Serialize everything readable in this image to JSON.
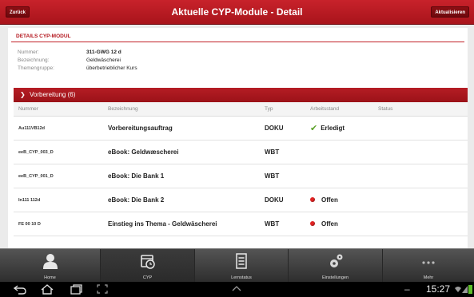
{
  "header": {
    "back_label": "Zurück",
    "title": "Aktuelle CYP-Module - Detail",
    "refresh_label": "Aktualisieren"
  },
  "details": {
    "heading": "DETAILS CYP-MODUL",
    "fields": [
      {
        "label": "Nummer:",
        "value": "311-GWG 12 d"
      },
      {
        "label": "Bezeichnung:",
        "value": "Geldwäscherei"
      },
      {
        "label": "Themengruppe:",
        "value": "überbetrieblicher Kurs"
      }
    ]
  },
  "section": {
    "title": "Vorbereitung (6)"
  },
  "table": {
    "headers": [
      "Nummer",
      "Bezeichnung",
      "Typ",
      "Arbeitsstand",
      "Status"
    ],
    "rows": [
      {
        "nummer": "Au111VB12d",
        "bezeichnung": "Vorbereitungsauftrag",
        "typ": "DOKU",
        "arbeitsstand": "Erledigt",
        "state": "done"
      },
      {
        "nummer": "eeB_CYP_003_D",
        "bezeichnung": "eBook: Geldwæscherei",
        "typ": "WBT",
        "arbeitsstand": "",
        "state": "none"
      },
      {
        "nummer": "eeB_CYP_001_D",
        "bezeichnung": "eBook: Die Bank 1",
        "typ": "WBT",
        "arbeitsstand": "",
        "state": "none"
      },
      {
        "nummer": "In111 112d",
        "bezeichnung": "eBook: Die Bank 2",
        "typ": "DOKU",
        "arbeitsstand": "Offen",
        "state": "open"
      },
      {
        "nummer": "FE 00 10 D",
        "bezeichnung": "Einstieg ins Thema - Geldwäscherei",
        "typ": "WBT",
        "arbeitsstand": "Offen",
        "state": "open"
      }
    ]
  },
  "tabs": [
    {
      "label": "Home",
      "icon": "person-icon",
      "active": false
    },
    {
      "label": "CYP",
      "icon": "calendar-clock-icon",
      "active": true
    },
    {
      "label": "Lernstatus",
      "icon": "list-icon",
      "active": false
    },
    {
      "label": "Einstellungen",
      "icon": "gears-icon",
      "active": false
    },
    {
      "label": "Mehr",
      "icon": "more-dots-icon",
      "active": false
    }
  ],
  "system_bar": {
    "time": "15:27",
    "dash": "–"
  },
  "colors": {
    "brand_red": "#b3151c",
    "done_green": "#5da22a",
    "open_red": "#e02424"
  }
}
